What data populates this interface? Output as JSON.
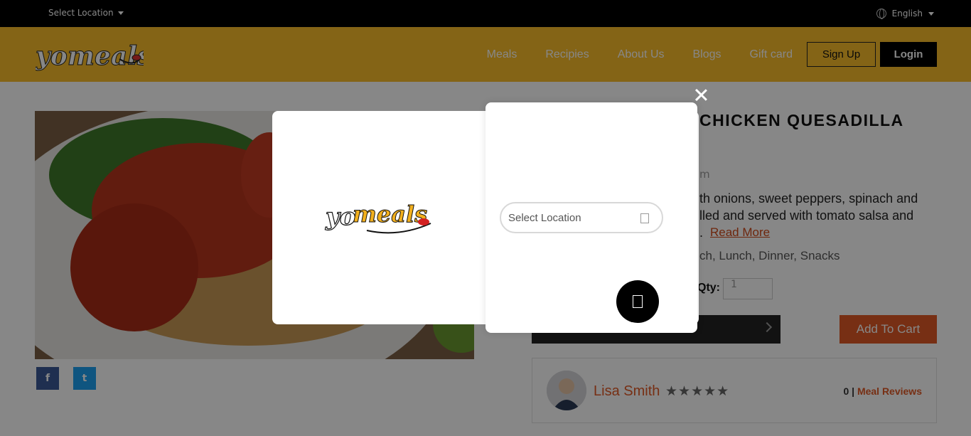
{
  "topbar": {
    "location_label": "Select Location",
    "language_label": "English"
  },
  "header": {
    "logo_text": "yomeals",
    "nav": [
      "Meals",
      "Recipies",
      "About Us",
      "Blogs",
      "Gift card"
    ],
    "signup_label": "Sign Up",
    "login_label": "Login"
  },
  "product": {
    "title": "CHICKEN QUESADILLA",
    "fragment_m": "m",
    "desc_line1": "th onions, sweet peppers, spinach and",
    "desc_line2": "lled and served with tomato salsa and",
    "desc_line3": ".",
    "read_more": "Read More",
    "meal_types": "ch, Lunch, Dinner, Snacks",
    "qty_label": "Qty:",
    "qty_value": "1",
    "add_to_cart": "Add To Cart",
    "share_fb": "f",
    "share_tw": "t"
  },
  "review": {
    "reviewer": "Lisa Smith",
    "stars": "★★★★★",
    "count": "0 |",
    "link": "Meal Reviews"
  },
  "modal": {
    "logo_text": "yomeals",
    "location_placeholder": "Select Location",
    "close_icon": "close-icon",
    "go_icon": "square-icon"
  },
  "colors": {
    "brand_yellow": "#f9be2a",
    "accent_orange": "#e05a26",
    "overlay": "rgba(0,0,0,0.47)"
  }
}
